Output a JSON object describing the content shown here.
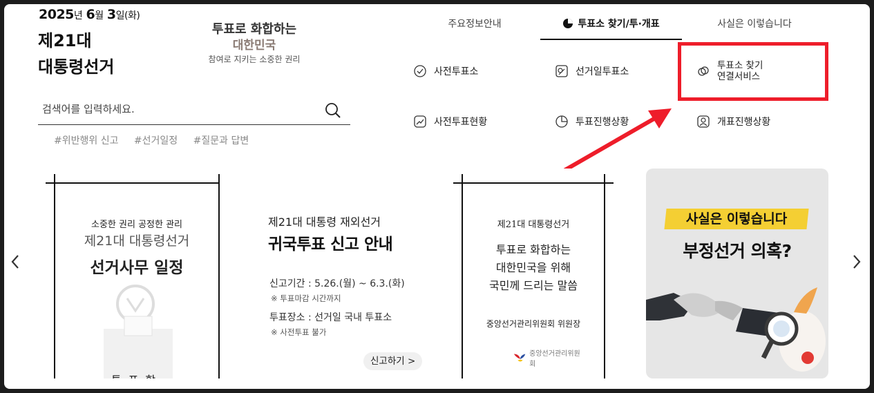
{
  "header": {
    "date": {
      "year": "2025",
      "year_unit": "년",
      "month": "6",
      "month_unit": "월",
      "day": "3",
      "day_unit": "일(화)"
    },
    "title_line1": "제21대",
    "title_line2": "대통령선거",
    "slogan": {
      "line1": "투표로 화합하는",
      "line2": "대한민국",
      "line3": "참여로 지키는 소중한 권리"
    }
  },
  "search": {
    "placeholder": "검색어를 입력하세요.",
    "hashtags": [
      "#위반행위 신고",
      "#선거일정",
      "#질문과 답변"
    ]
  },
  "tabs": [
    {
      "label": "주요정보안내"
    },
    {
      "label": "투표소 찾기/투·개표"
    },
    {
      "label": "사실은 이렇습니다"
    }
  ],
  "services": [
    {
      "label": "사전투표소",
      "icon": "check-circle-icon"
    },
    {
      "label": "선거일투표소",
      "icon": "ballot-icon"
    },
    {
      "label_line1": "투표소 찾기",
      "label_line2": "연결서비스",
      "icon": "link-icon"
    },
    {
      "label": "사전투표현황",
      "icon": "chart-up-icon"
    },
    {
      "label": "투표진행상황",
      "icon": "pie-icon"
    },
    {
      "label": "개표진행상황",
      "icon": "person-icon"
    }
  ],
  "carousel": {
    "card1": {
      "line1": "소중한 권리 공정한 관리",
      "line2": "제21대 대통령선거",
      "line3": "선거사무 일정",
      "box_label": "투표함"
    },
    "card2": {
      "line1": "제21대 대통령 재외선거",
      "line2": "귀국투표 신고 안내",
      "period": "신고기간 : 5.26.(월) ~ 6.3.(화)",
      "period_note": "※ 투표마감 시간까지",
      "place": "투표장소 : 선거일 국내 투표소",
      "place_note": "※ 사전투표 불가",
      "button": "신고하기 >"
    },
    "card3": {
      "line1": "제21대 대통령선거",
      "line2": "투표로 화합하는",
      "line3": "대한민국을 위해",
      "line4": "국민께 드리는 말씀",
      "line5": "중앙선거관리위원회 위원장",
      "logo_text": "중앙선거관리위원회"
    },
    "card4": {
      "line1": "사실은 이렇습니다",
      "line2": "부정선거 의혹?"
    }
  },
  "colors": {
    "highlight": "#ee1d2a",
    "tag": "#f4cf33"
  }
}
